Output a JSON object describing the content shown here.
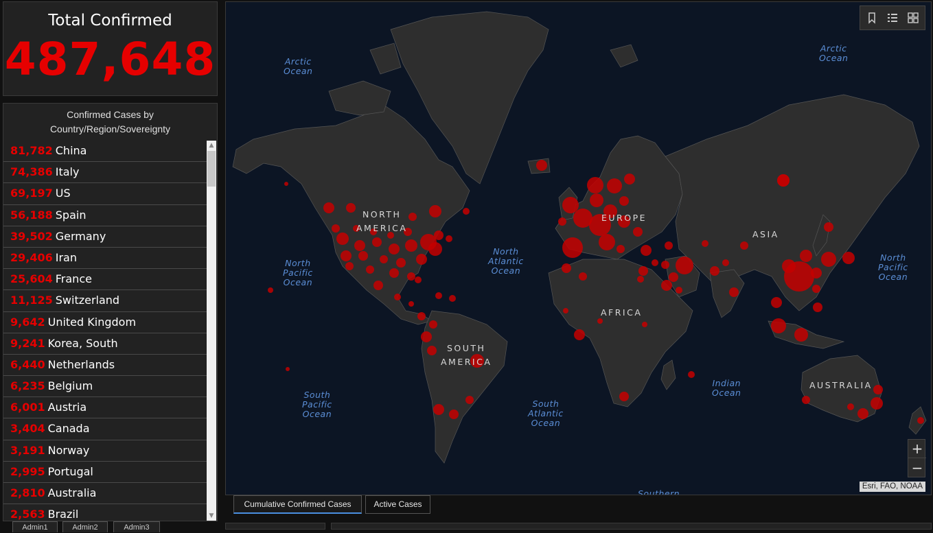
{
  "total": {
    "title": "Total Confirmed",
    "value": "487,648"
  },
  "list": {
    "header_line1": "Confirmed Cases by",
    "header_line2": "Country/Region/Sovereignty",
    "items": [
      {
        "count": "81,782",
        "name": "China"
      },
      {
        "count": "74,386",
        "name": "Italy"
      },
      {
        "count": "69,197",
        "name": "US"
      },
      {
        "count": "56,188",
        "name": "Spain"
      },
      {
        "count": "39,502",
        "name": "Germany"
      },
      {
        "count": "29,406",
        "name": "Iran"
      },
      {
        "count": "25,604",
        "name": "France"
      },
      {
        "count": "11,125",
        "name": "Switzerland"
      },
      {
        "count": "9,642",
        "name": "United Kingdom"
      },
      {
        "count": "9,241",
        "name": "Korea, South"
      },
      {
        "count": "6,440",
        "name": "Netherlands"
      },
      {
        "count": "6,235",
        "name": "Belgium"
      },
      {
        "count": "6,001",
        "name": "Austria"
      },
      {
        "count": "3,404",
        "name": "Canada"
      },
      {
        "count": "3,191",
        "name": "Norway"
      },
      {
        "count": "2,995",
        "name": "Portugal"
      },
      {
        "count": "2,810",
        "name": "Australia"
      },
      {
        "count": "2,563",
        "name": "Brazil"
      }
    ]
  },
  "admin_tabs": [
    "Admin1",
    "Admin2",
    "Admin3"
  ],
  "map": {
    "ocean_labels": [
      "Arctic\nOcean",
      "Arctic\nOcean",
      "North\nPacific\nOcean",
      "North\nAtlantic\nOcean",
      "North\nPacific\nOcean",
      "South\nPacific\nOcean",
      "South\nAtlantic\nOcean",
      "Indian\nOcean",
      "Southern"
    ],
    "continent_labels": [
      "NORTH\nAMERICA",
      "EUROPE",
      "ASIA",
      "AFRICA",
      "SOUTH\nAMERICA",
      "AUSTRALIA"
    ],
    "tools": [
      "bookmark-icon",
      "legend-list-icon",
      "basemap-gallery-icon"
    ],
    "zoom_in": "+",
    "zoom_out": "−",
    "attribution": "Esri, FAO, NOAA",
    "marker_color": "#c40000"
  },
  "map_tabs": [
    {
      "label": "Cumulative Confirmed Cases",
      "active": true
    },
    {
      "label": "Active Cases",
      "active": false
    }
  ]
}
